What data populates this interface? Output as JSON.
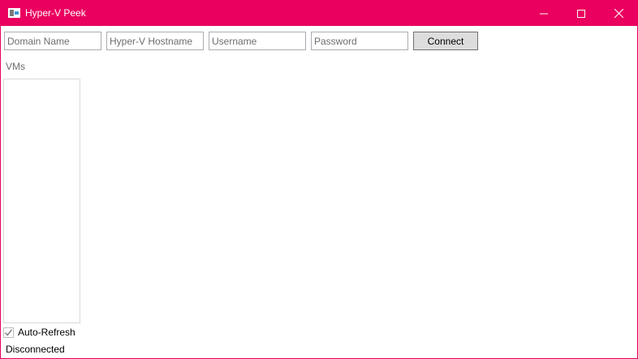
{
  "window": {
    "title": "Hyper-V Peek",
    "accent_color": "#ea005e",
    "controls": {
      "minimize_icon": "minimize-icon",
      "maximize_icon": "maximize-icon",
      "close_icon": "close-icon"
    }
  },
  "connection": {
    "domain_placeholder": "Domain Name",
    "hostname_placeholder": "Hyper-V Hostname",
    "username_placeholder": "Username",
    "password_placeholder": "Password",
    "connect_label": "Connect"
  },
  "vms": {
    "label": "VMs",
    "items": []
  },
  "auto_refresh": {
    "label": "Auto-Refresh",
    "checked": true,
    "enabled": false
  },
  "status": {
    "text": "Disconnected"
  }
}
